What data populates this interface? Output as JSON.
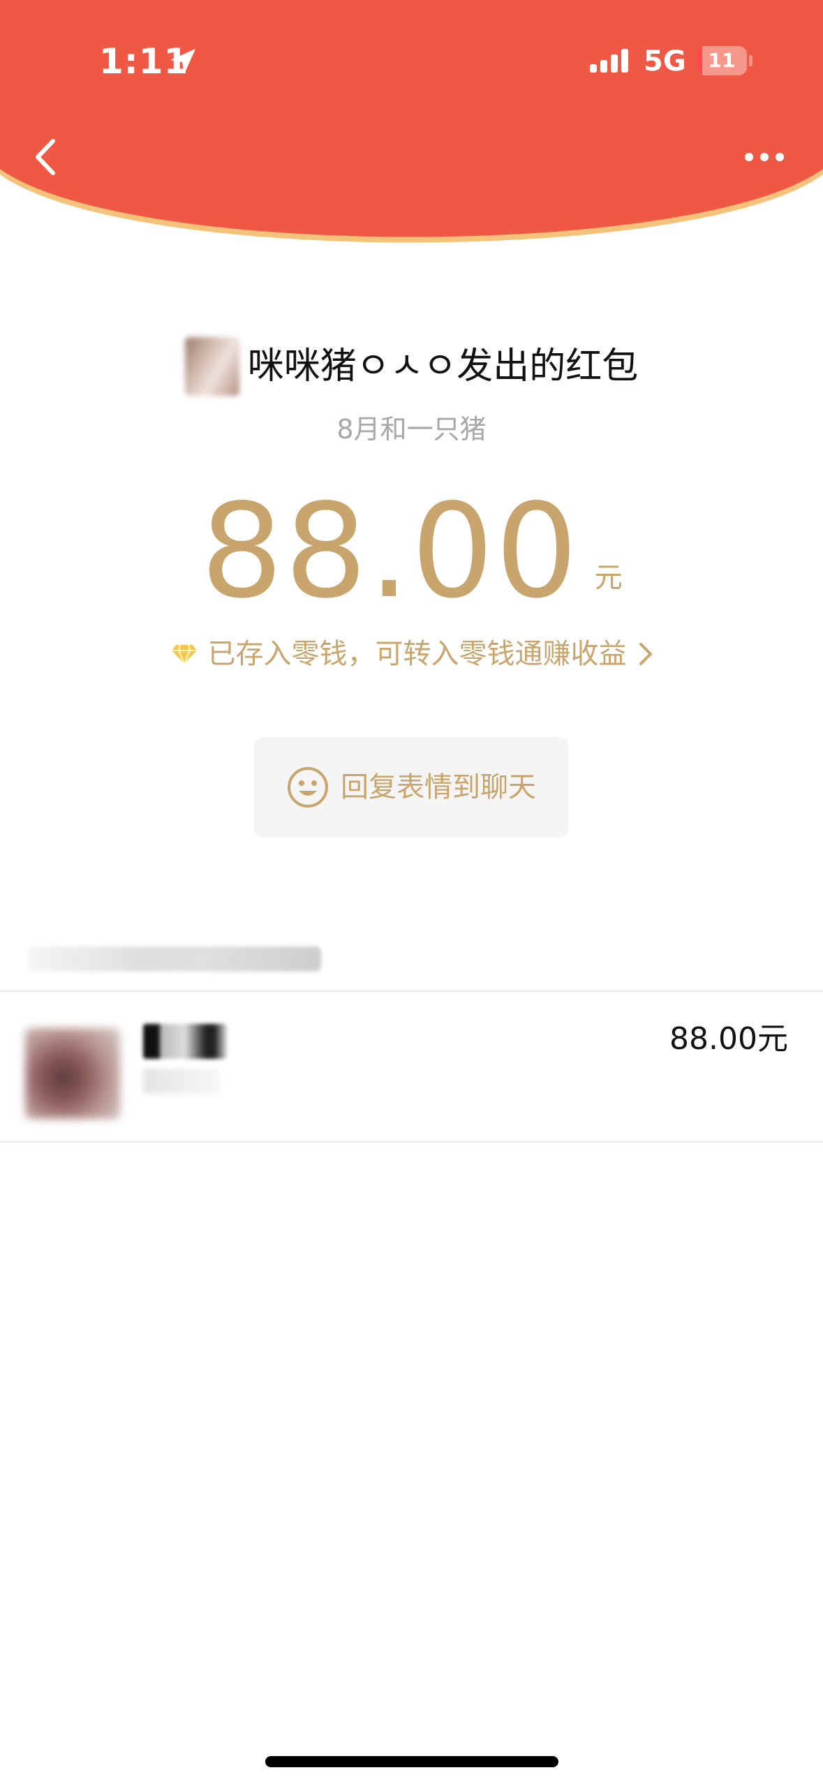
{
  "colors": {
    "header_red": "#f05846",
    "header_rim": "#f5c27a",
    "gold": "#c7a56d",
    "divider": "#ebebeb",
    "reply_bg": "#f5f5f5"
  },
  "status_bar": {
    "time": "1:11",
    "network": "5G",
    "battery": "11",
    "battery_level_percent": 11
  },
  "nav": {
    "back_icon": "chevron-left-icon",
    "more_icon": "ellipsis-icon"
  },
  "envelope": {
    "sender_title": "咪咪猪ㅇㅅㅇ发出的红包",
    "blessing": "8月和一只猪",
    "amount": "88.00",
    "unit": "元",
    "wallet_notice": "已存入零钱，可转入零钱通赚收益"
  },
  "reply": {
    "icon": "smiley-icon",
    "label": "回复表情到聊天"
  },
  "receivers": [
    {
      "amount": "88.00元"
    }
  ]
}
